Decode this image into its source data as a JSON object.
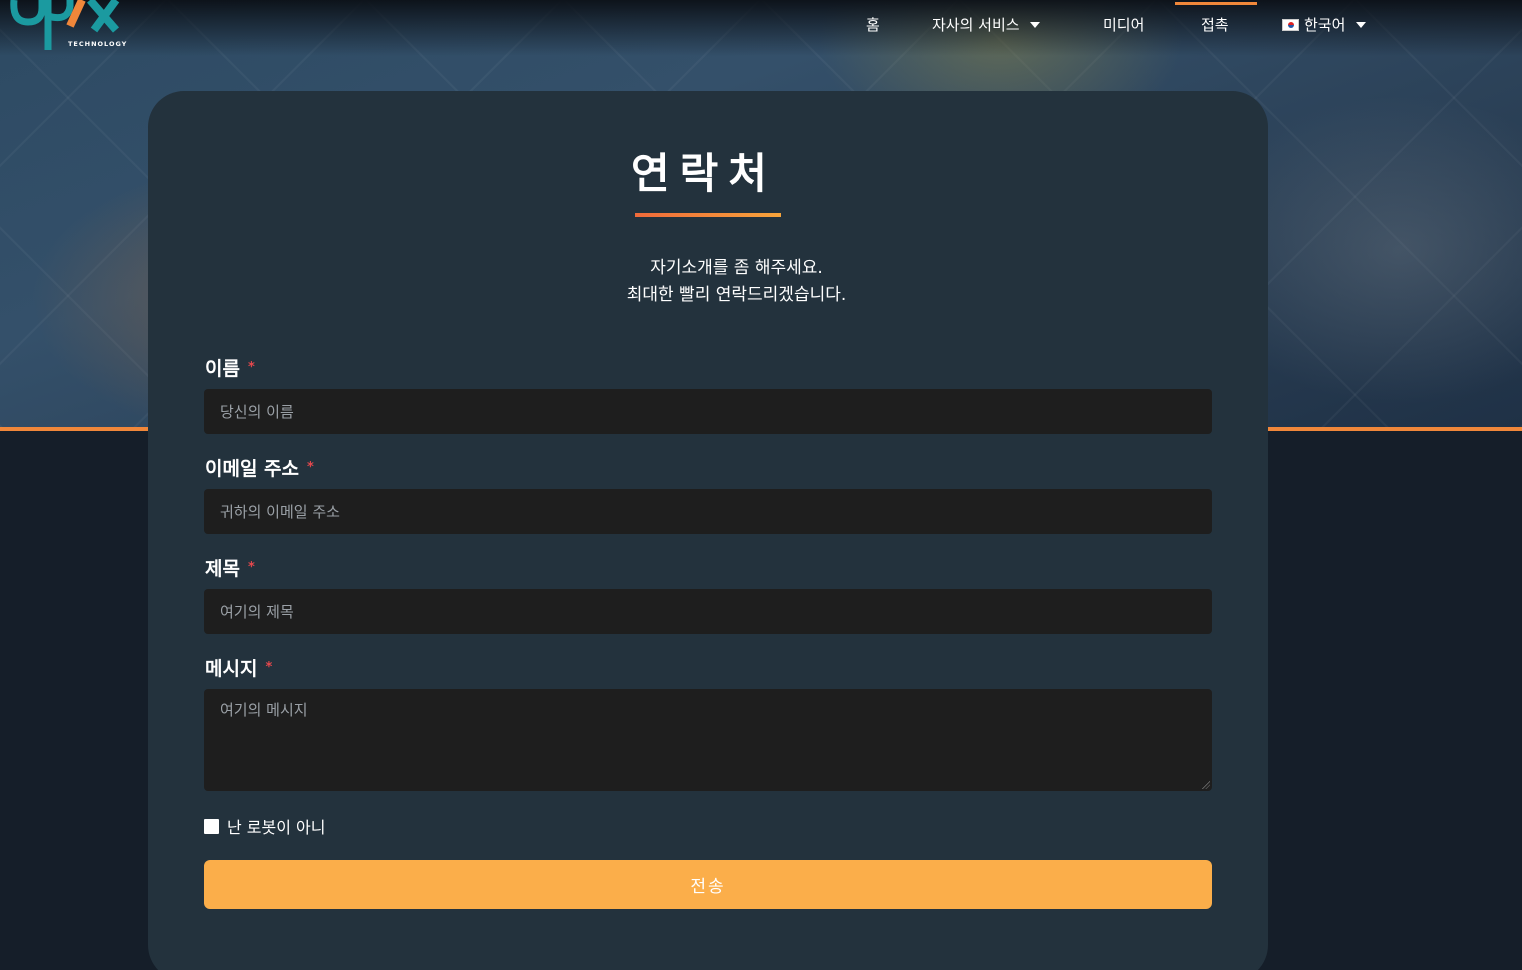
{
  "brand": {
    "tagline": "TECHNOLOGY",
    "accent": "#f0873a",
    "teal": "#1b9aa0"
  },
  "nav": {
    "home": "홈",
    "services": "자사의 서비스",
    "media": "미디어",
    "contact": "접촉",
    "language": "한국어"
  },
  "contact": {
    "title": "연락처",
    "subtitle_line1": "자기소개를 좀 해주세요.",
    "subtitle_line2": "최대한 빨리 연락드리겠습니다.",
    "required_mark": "*",
    "fields": [
      {
        "label": "이름",
        "placeholder": "당신의 이름"
      },
      {
        "label": "이메일 주소",
        "placeholder": "귀하의 이메일 주소"
      },
      {
        "label": "제목",
        "placeholder": "여기의 제목"
      },
      {
        "label": "메시지",
        "placeholder": "여기의 메시지"
      }
    ],
    "captcha_label": "난 로봇이 아니",
    "submit_label": "전송",
    "submit_color": "#fbae4a"
  }
}
